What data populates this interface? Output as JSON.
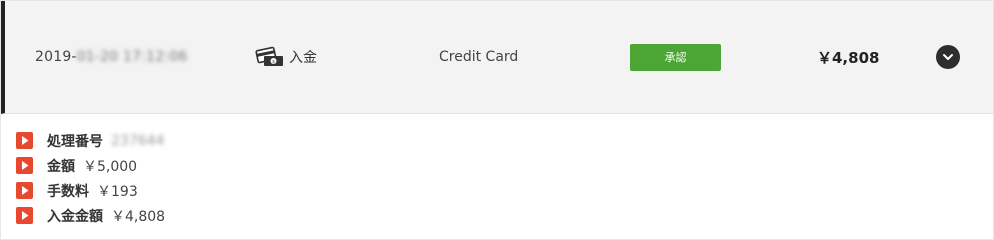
{
  "transaction": {
    "date_prefix": "2019-",
    "date_rest": "01-20 17:12:06",
    "type_label": "入金",
    "type_icon": "card-and-cash-icon",
    "method": "Credit Card",
    "status": "承認",
    "status_color": "#4ca534",
    "amount": "￥4,808",
    "toggle_icon": "chevron-down-icon"
  },
  "details": [
    {
      "label": "処理番号",
      "value": "237644"
    },
    {
      "label": "金額",
      "value": "￥5,000"
    },
    {
      "label": "手数料",
      "value": "￥193"
    },
    {
      "label": "入金金額",
      "value": "￥4,808"
    }
  ],
  "colors": {
    "marker": "#e8492e",
    "row_background": "#f3f3f3",
    "row_border_accent": "#222222"
  }
}
